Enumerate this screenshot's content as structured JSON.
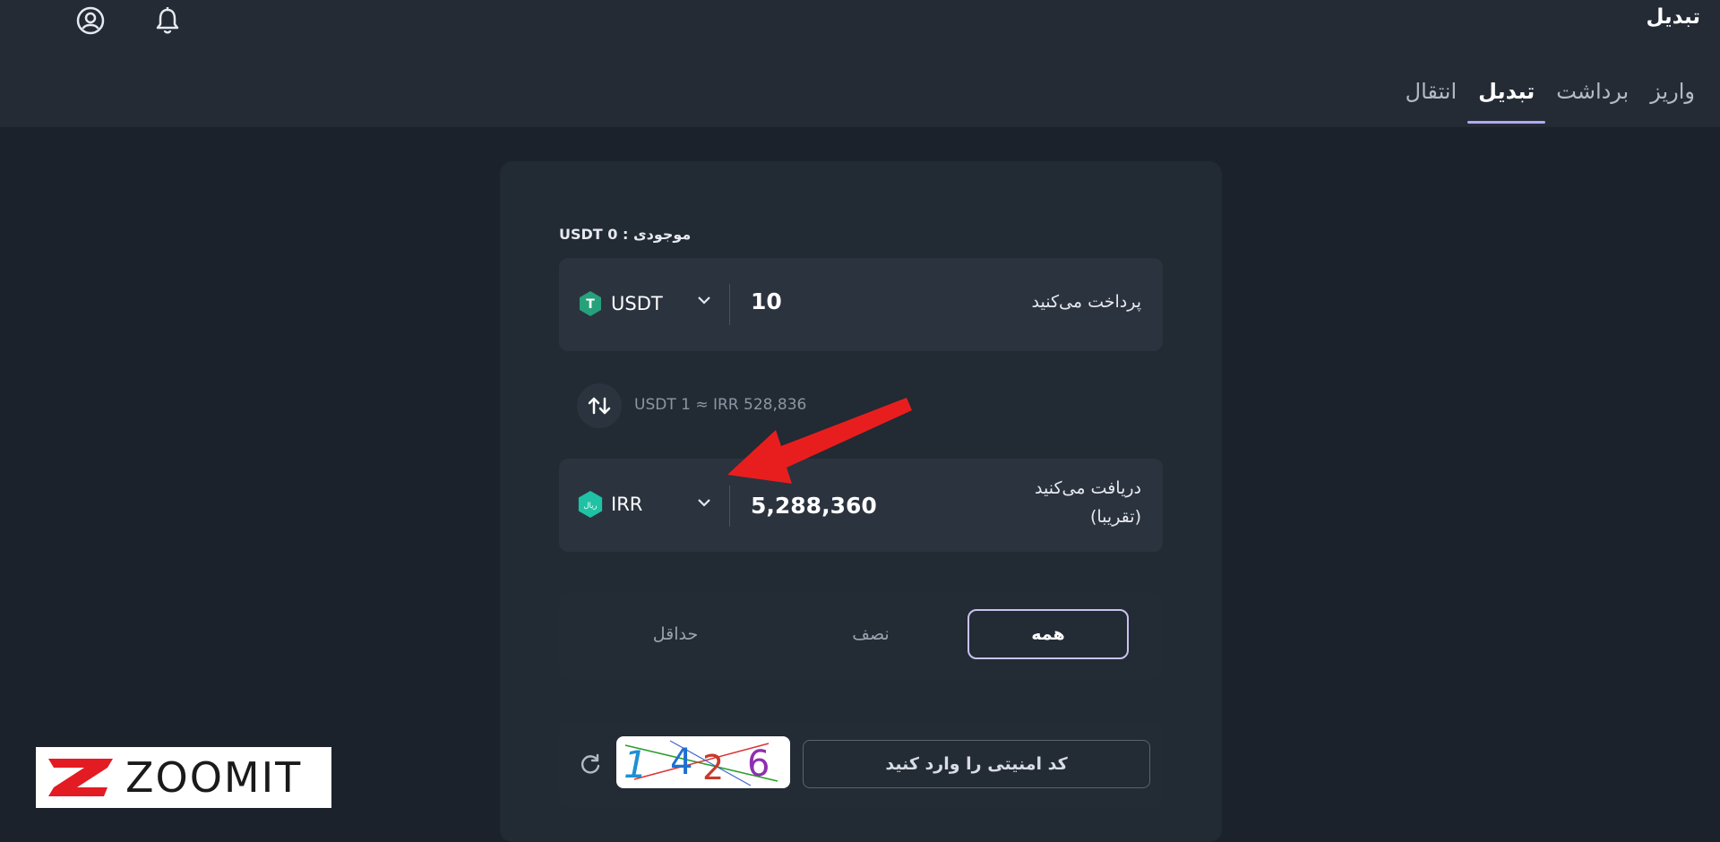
{
  "header": {
    "title": "تبدیل",
    "tabs": [
      {
        "label": "واریز",
        "active": false
      },
      {
        "label": "برداشت",
        "active": false
      },
      {
        "label": "تبدیل",
        "active": true
      },
      {
        "label": "انتقال",
        "active": false
      }
    ]
  },
  "balance": "USDT 0 : موجودی",
  "pay": {
    "label": "پرداخت می‌کنید",
    "value": "10",
    "currency": "USDT",
    "icon": "tether-icon"
  },
  "rate": "USDT 1 ≈ IRR 528,836",
  "receive": {
    "label_line1": "دریافت می‌کنید",
    "label_line2": "(تقریبا)",
    "value": "5,288,360",
    "currency": "IRR",
    "icon": "rial-icon",
    "icon_text": "ریال"
  },
  "percent_options": [
    {
      "label": "همه",
      "active": true
    },
    {
      "label": "نصف",
      "active": false
    },
    {
      "label": "حداقل",
      "active": false
    }
  ],
  "captcha": {
    "placeholder": "کد امنیتی را وارد کنید",
    "image_text": "1 4 2 6"
  },
  "watermark": "ZOOMIT",
  "colors": {
    "accent": "#b5a7f2",
    "tether": "#26a17b",
    "rial": "#1fc2a4",
    "arrow": "#e81e1e"
  }
}
